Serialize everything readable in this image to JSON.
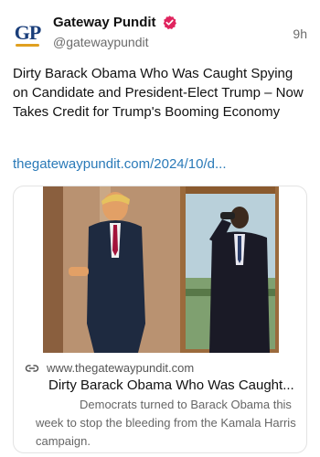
{
  "author": {
    "avatar_text": "GP",
    "display_name": "Gateway Pundit",
    "handle": "@gatewaypundit",
    "verified": true,
    "verified_icon": "verified-badge-icon",
    "verified_color": "#e0245e"
  },
  "post": {
    "time": "9h",
    "text": "Dirty Barack Obama Who Was Caught Spying on Candidate and President-Elect Trump – Now Takes Credit for Trump's Booming Economy",
    "link": "thegatewaypundit.com/2024/10/d..."
  },
  "card": {
    "link_icon": "link-icon",
    "domain": "www.thegatewaypundit.com",
    "title": "Dirty Barack Obama Who Was Caught...",
    "description": "Democrats turned to Barack Obama this week to stop the bleeding from the Kamala Harris campaign."
  },
  "colors": {
    "link": "#2a7ab8",
    "secondary_text": "#6b6b6b",
    "brand_blue": "#1a3e7a",
    "brand_gold": "#e0a020"
  }
}
